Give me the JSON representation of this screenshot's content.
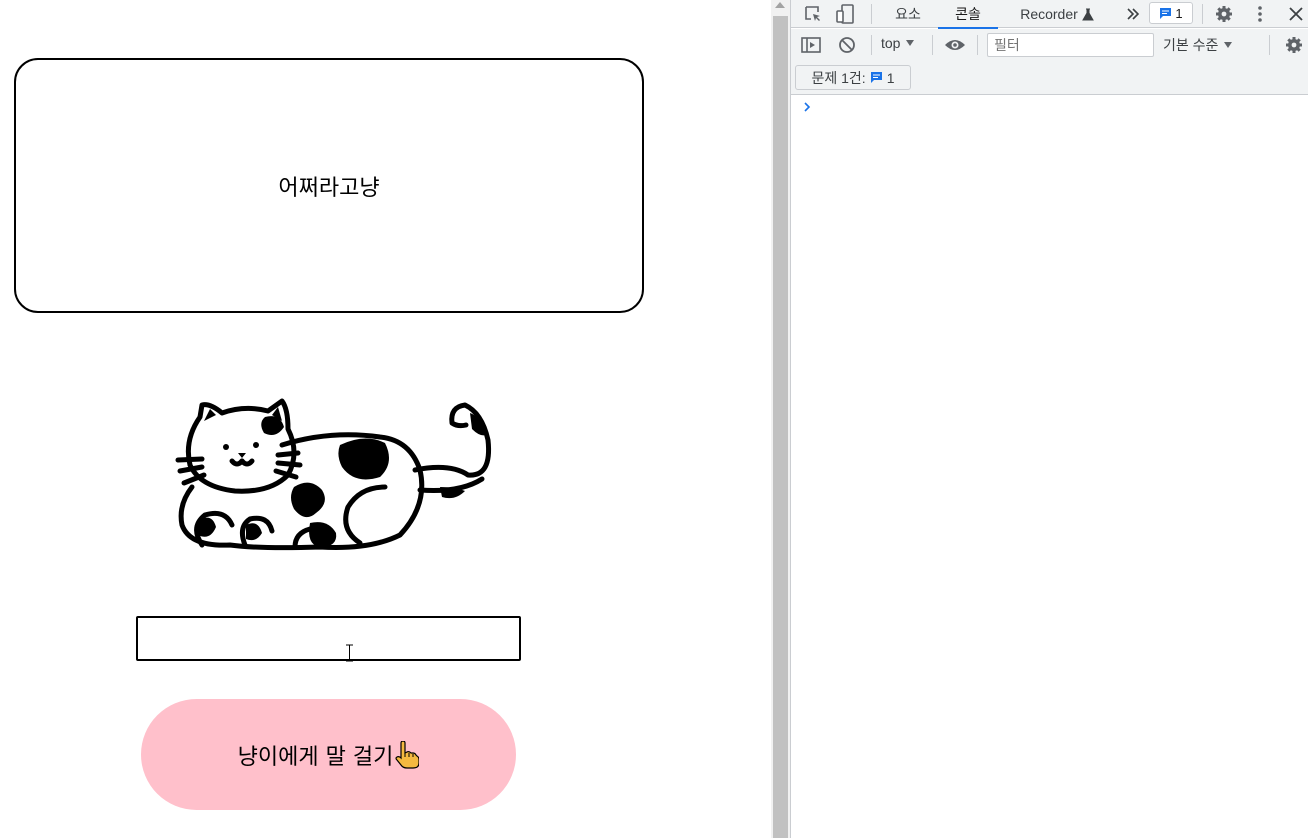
{
  "page": {
    "bubble_text": "어쩌라고냥",
    "input_value": "",
    "button_label": "냥이에게 말 걸기"
  },
  "devtools": {
    "tabs": [
      "요소",
      "콘솔",
      "Recorder"
    ],
    "active_tab": "콘솔",
    "issue_count": "1",
    "context": "top",
    "filter_placeholder": "필터",
    "level_label": "기본 수준",
    "issues_label": "문제 1건:",
    "issues_count": "1"
  },
  "colors": {
    "button_bg": "#ffc0cb",
    "accent": "#1a73e8"
  },
  "icons": [
    "inspect-icon",
    "device-toggle-icon",
    "flask-icon",
    "more-tabs-icon",
    "message-icon",
    "gear-icon",
    "kebab-icon",
    "close-icon",
    "sidebar-icon",
    "clear-icon",
    "eye-icon",
    "chevron-right-icon",
    "pointing-hand-icon",
    "cat-illustration"
  ]
}
